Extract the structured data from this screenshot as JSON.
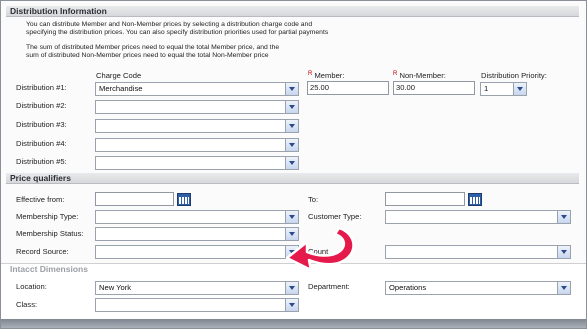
{
  "distribution": {
    "header": "Distribution Information",
    "note1_line1": "You can distribute Member and Non-Member prices by selecting a distribution charge code and",
    "note1_line2": "specifying the distribution prices. You can also specify distribution priorities used for partial payments",
    "note2_line1": "The sum of distributed Member prices need to equal the total Member price, and the",
    "note2_line2": "sum of distributed Non-Member prices need to equal the total Non-Member price",
    "col_charge_code": "Charge Code",
    "col_member": "Member:",
    "col_nonmember": "Non-Member:",
    "col_priority": "Distribution Priority:",
    "rows": [
      {
        "label": "Distribution #1:",
        "charge_code": "Merchandise",
        "member": "25.00",
        "nonmember": "30.00",
        "priority": "1"
      },
      {
        "label": "Distribution #2:",
        "charge_code": ""
      },
      {
        "label": "Distribution #3:",
        "charge_code": ""
      },
      {
        "label": "Distribution #4:",
        "charge_code": ""
      },
      {
        "label": "Distribution #5:",
        "charge_code": ""
      }
    ]
  },
  "qualifiers": {
    "header": "Price qualifiers",
    "effective_from_label": "Effective from:",
    "effective_from_value": "",
    "to_label": "To:",
    "to_value": "",
    "membership_type_label": "Membership Type:",
    "customer_type_label": "Customer Type:",
    "membership_status_label": "Membership Status:",
    "record_source_label": "Record Source:",
    "country_label_partial": "Count"
  },
  "intacct": {
    "header": "Intacct Dimensions",
    "location_label": "Location:",
    "location_value": "New York",
    "department_label": "Department:",
    "department_value": "Operations",
    "class_label": "Class:",
    "class_value": ""
  },
  "colors": {
    "arrow_fill": "#e6194b",
    "arrow_outline": "#ffffff",
    "select_button": "#c7d6ee",
    "calendar_icon": "#2f5ea8"
  }
}
